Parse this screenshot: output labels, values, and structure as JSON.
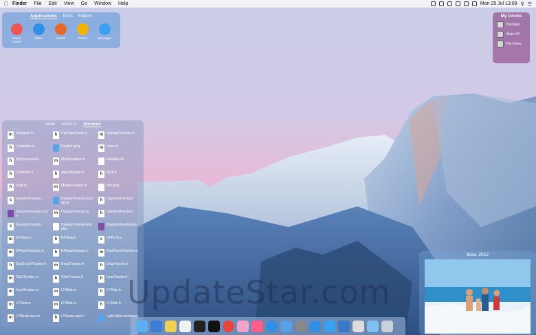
{
  "menubar": {
    "app_name": "Finder",
    "items": [
      "File",
      "Edit",
      "View",
      "Go",
      "Window",
      "Help"
    ],
    "clock": "Mon 25 Jul  13:09"
  },
  "apps_panel": {
    "tabs": [
      "Applications",
      "Tools",
      "Editors"
    ],
    "apps": [
      {
        "label": "Game Center",
        "color": "#e55"
      },
      {
        "label": "Safari",
        "color": "#2f8fe8"
      },
      {
        "label": "Vivaldi",
        "color": "#e86a2a"
      },
      {
        "label": "Photos",
        "color": "#f3b400"
      },
      {
        "label": "Messages",
        "color": "#3aa0f0"
      }
    ]
  },
  "drives_panel": {
    "title": "My Drives",
    "drives": [
      "Backups",
      "Main HD",
      "Pen Drive"
    ]
  },
  "sources_panel": {
    "tabs": [
      "Icons",
      "Icons 2",
      "Sources"
    ],
    "active_tab": "Sources",
    "files": [
      {
        "name": "Delegate.m",
        "kind": "m"
      },
      {
        "name": "CallDataCenter.h",
        "kind": "h"
      },
      {
        "name": "DisplayCoreFile.m",
        "kind": "m"
      },
      {
        "name": "Controller.m",
        "kind": "h"
      },
      {
        "name": "English.lproj",
        "kind": "folder"
      },
      {
        "name": "main.m",
        "kind": "m"
      },
      {
        "name": "MyDocument.h",
        "kind": "h"
      },
      {
        "name": "MyDocument.m",
        "kind": "m"
      },
      {
        "name": "ReadMe.txt",
        "kind": "txt"
      },
      {
        "name": "Controller.h",
        "kind": "h"
      },
      {
        "name": "AppDelegate.h",
        "kind": "h"
      },
      {
        "name": "Stuff.h",
        "kind": "h"
      },
      {
        "name": "Stuff.m",
        "kind": "h"
      },
      {
        "name": "MyAppTracker.m",
        "kind": "m"
      },
      {
        "name": "Info.plist",
        "kind": "txt"
      },
      {
        "name": "DispatchFractal.c",
        "kind": "c"
      },
      {
        "name": "DispatchFractal.xcodeproj",
        "kind": "blue"
      },
      {
        "name": "DispatchFractal.h",
        "kind": "h"
      },
      {
        "name": "DispatchFractal.xcode",
        "kind": "purple"
      },
      {
        "name": "DispatchFractal.m",
        "kind": "m"
      },
      {
        "name": "DispatchFractal.h",
        "kind": "h"
      },
      {
        "name": "DispatchFractal.c",
        "kind": "c"
      },
      {
        "name": "DispatchFractal-Info.plist",
        "kind": "txt"
      },
      {
        "name": "DispatchFractal.mm",
        "kind": "purple"
      },
      {
        "name": "DFView.m",
        "kind": "m"
      },
      {
        "name": "DFView.h",
        "kind": "h"
      },
      {
        "name": "DFPrefs.c",
        "kind": "c"
      },
      {
        "name": "DFAppDelegate.m",
        "kind": "m"
      },
      {
        "name": "DFAppDelegate.h",
        "kind": "h"
      },
      {
        "name": "DualTouchTracker.m",
        "kind": "m"
      },
      {
        "name": "DualTouchTracker.h",
        "kind": "h"
      },
      {
        "name": "DragTracker.m",
        "kind": "m"
      },
      {
        "name": "DragTracker.h",
        "kind": "h"
      },
      {
        "name": "ClickTracker.m",
        "kind": "m"
      },
      {
        "name": "ClickTracker.h",
        "kind": "h"
      },
      {
        "name": "InputTracker.h",
        "kind": "h"
      },
      {
        "name": "InputTracker.m",
        "kind": "m"
      },
      {
        "name": "LTSlide.m",
        "kind": "m"
      },
      {
        "name": "LTSlide.h",
        "kind": "h"
      },
      {
        "name": "LTView.m",
        "kind": "m"
      },
      {
        "name": "LTSlide.m",
        "kind": "m"
      },
      {
        "name": "LTSlide.h",
        "kind": "h"
      },
      {
        "name": "LTMaskLayer.m",
        "kind": "m"
      },
      {
        "name": "LTMaskLayer.h",
        "kind": "h"
      },
      {
        "name": "LightTable.xcodeproj",
        "kind": "blue"
      }
    ]
  },
  "photo_panel": {
    "caption": "Ibiza, 2012"
  },
  "watermark": "UpdateStar.com",
  "dock": {
    "items": [
      {
        "name": "finder",
        "color": "#5ab0f0"
      },
      {
        "name": "preview",
        "color": "#3a7fd5"
      },
      {
        "name": "notes",
        "color": "#f0d050"
      },
      {
        "name": "pages",
        "color": "#f0f0f0"
      },
      {
        "name": "terminal",
        "color": "#222"
      },
      {
        "name": "activity-monitor",
        "color": "#111"
      },
      {
        "name": "chrome",
        "color": "#e8453c"
      },
      {
        "name": "photos",
        "color": "#f2a3c8"
      },
      {
        "name": "itunes",
        "color": "#ff5e8a"
      },
      {
        "name": "app-store",
        "color": "#2f8fe8"
      },
      {
        "name": "xcode",
        "color": "#5aa0e8"
      },
      {
        "name": "system-preferences",
        "color": "#888"
      },
      {
        "name": "safari",
        "color": "#2f8fe8"
      },
      {
        "name": "utilities",
        "color": "#3aa0f0"
      },
      {
        "name": "virtualbox",
        "color": "#3a78c8"
      },
      {
        "name": "screenshot",
        "color": "#ddd"
      },
      {
        "name": "folder",
        "color": "#7fc0f0"
      },
      {
        "name": "trash",
        "color": "#c8d0d8"
      }
    ]
  }
}
